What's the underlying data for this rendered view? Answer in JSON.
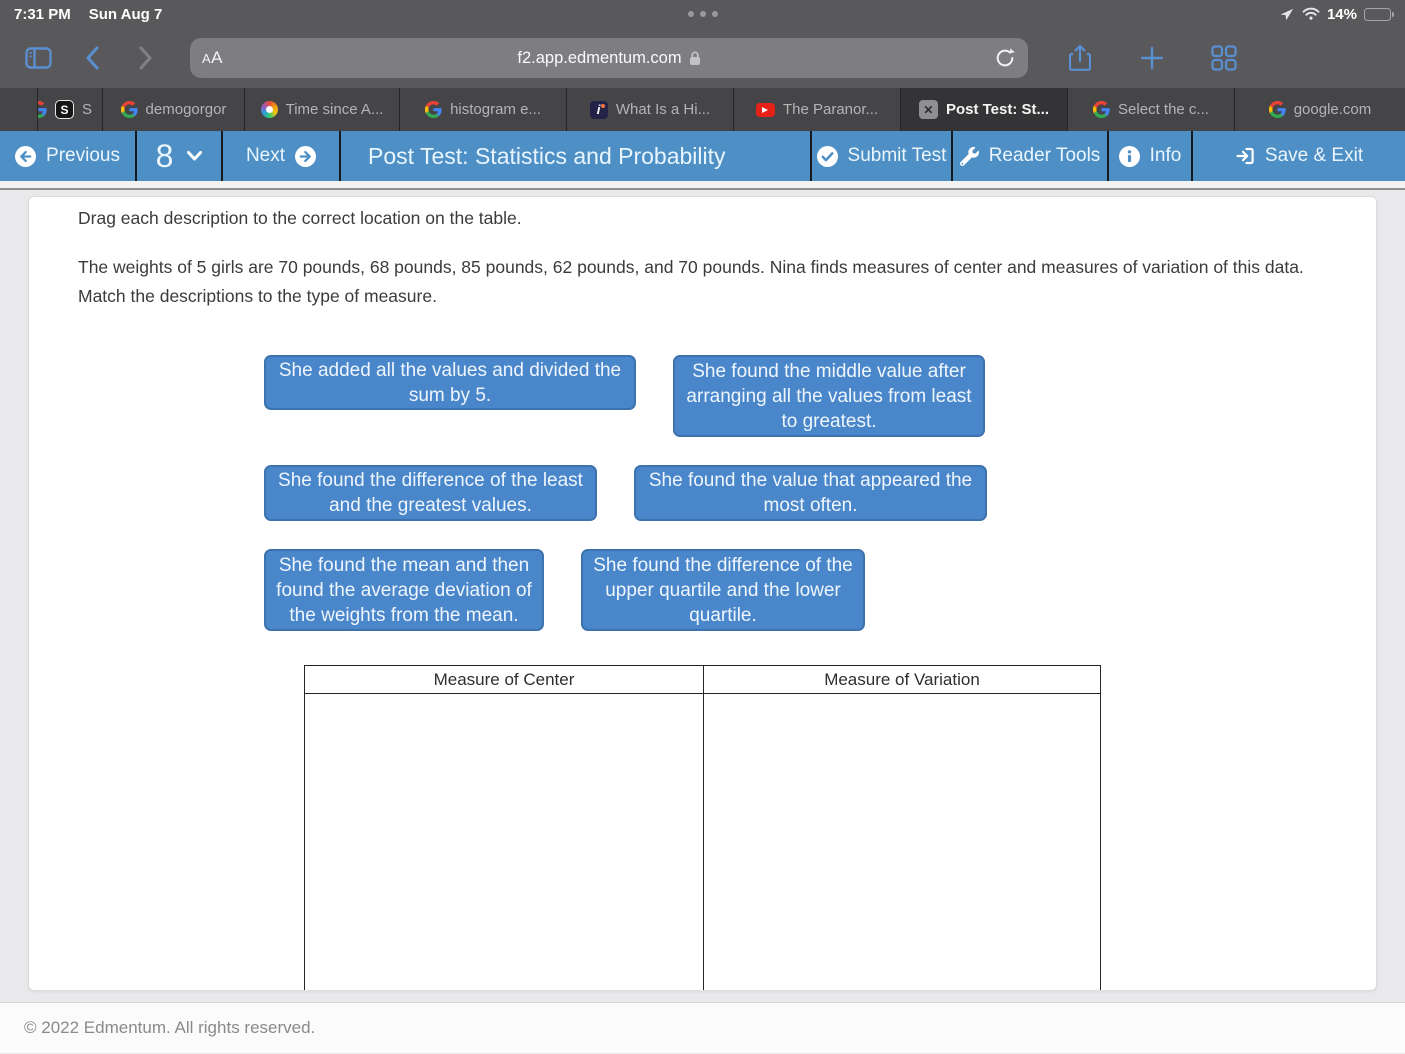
{
  "status_bar": {
    "time": "7:31 PM",
    "date": "Sun Aug 7",
    "battery_percent": "14%"
  },
  "browser": {
    "reader_label_small": "A",
    "reader_label_big": "A",
    "url": "f2.app.edmentum.com"
  },
  "tabs": [
    {
      "label": "",
      "icon": "google-clipped"
    },
    {
      "label": "S",
      "icon": "s-app"
    },
    {
      "label": "demogorgor",
      "icon": "google"
    },
    {
      "label": "Time since A...",
      "icon": "palette"
    },
    {
      "label": "histogram e...",
      "icon": "google"
    },
    {
      "label": "What Is a Hi...",
      "icon": "investopedia"
    },
    {
      "label": "The Paranor...",
      "icon": "youtube"
    },
    {
      "label": "Post Test: St...",
      "icon": "close",
      "active": true
    },
    {
      "label": "Select the c...",
      "icon": "google"
    },
    {
      "label": "google.com",
      "icon": "google"
    }
  ],
  "toolbar": {
    "previous_label": "Previous",
    "question_number": "8",
    "next_label": "Next",
    "title": "Post Test: Statistics and Probability",
    "submit_label": "Submit Test",
    "reader_tools_label": "Reader Tools",
    "info_label": "Info",
    "save_exit_label": "Save & Exit"
  },
  "question": {
    "instruction": "Drag each description to the correct location on the table.",
    "prompt": "The weights of 5 girls are 70 pounds, 68 pounds, 85 pounds, 62 pounds, and 70 pounds. Nina finds measures of center and measures of variation of this data. Match the descriptions to the type of measure.",
    "tiles": [
      "She added all the values and divided the sum by 5.",
      "She found the middle value after arranging all the values from least to greatest.",
      "She found the difference of the least and the greatest values.",
      "She found the value that appeared the most often.",
      "She found the mean and then found the average deviation of the weights from the mean.",
      "She found the difference of the upper quartile and the lower quartile."
    ],
    "table_columns": [
      "Measure of Center",
      "Measure of Variation"
    ]
  },
  "footer": {
    "copyright": "© 2022 Edmentum. All rights reserved."
  },
  "colors": {
    "toolbar_blue": "#4e90c5",
    "tile_blue": "#4a87ca",
    "chrome_gray": "#59595b",
    "battery_low": "#ff453a"
  }
}
